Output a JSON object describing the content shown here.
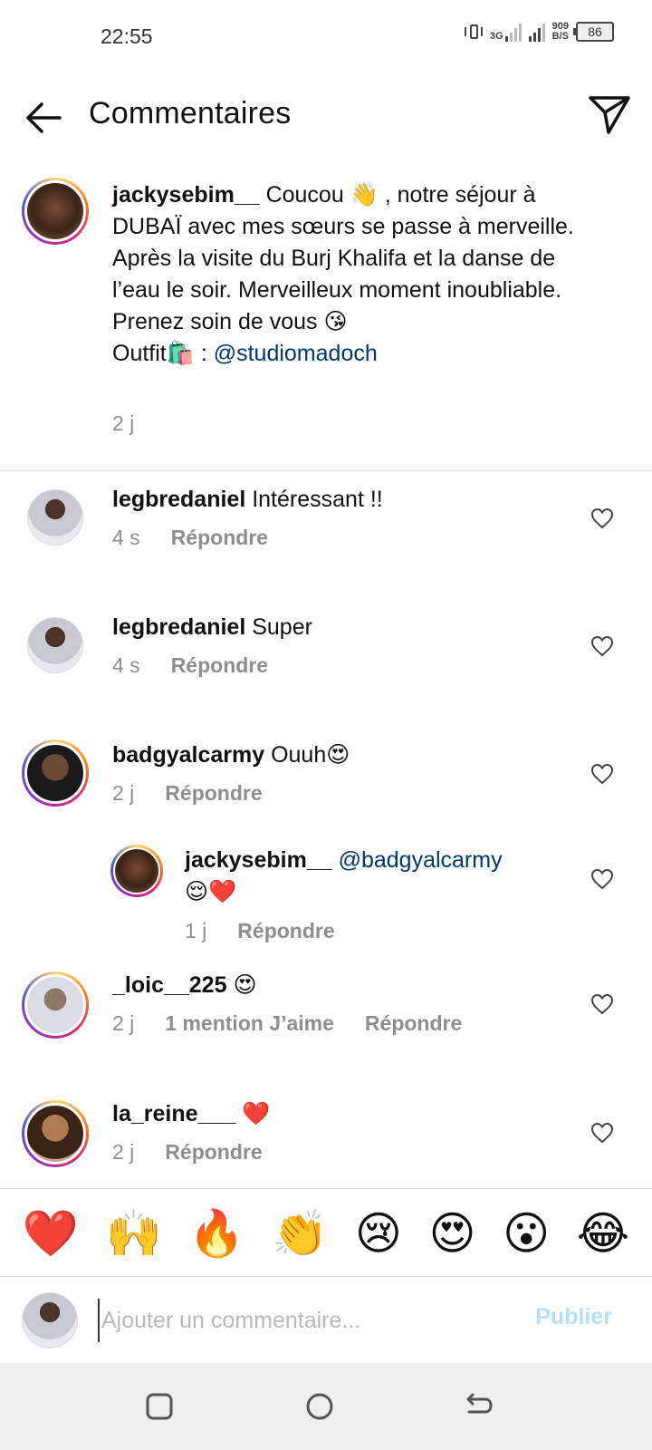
{
  "status_bar": {
    "time": "22:55",
    "network_type": "3G",
    "speed_value": "909",
    "speed_unit": "B/S",
    "battery": "86"
  },
  "header": {
    "title": "Commentaires",
    "back_icon": "arrow-left-icon",
    "send_icon": "paper-plane-icon"
  },
  "caption": {
    "username": "jackysebim__",
    "text_1": " Coucou 👋 , notre séjour à DUBAÏ avec mes sœurs se passe à merveille. Après la visite du Burj Khalifa et la danse de l’eau le soir. Merveilleux moment inoubliable. Prenez soin de vous 😘",
    "text_2": "Outfit🛍️ : ",
    "mention": "@studiomadoch",
    "time": "2 j"
  },
  "comments": [
    {
      "username": "legbredaniel",
      "text": " Intéressant !!",
      "time": "4 s",
      "reply": "Répondre"
    },
    {
      "username": "legbredaniel",
      "text": " Super",
      "time": "4 s",
      "reply": "Répondre"
    },
    {
      "username": "badgyalcarmy",
      "text": " Ouuh😍",
      "time": "2 j",
      "reply": "Répondre"
    },
    {
      "username": "jackysebim__",
      "mention": " @badgyalcarmy",
      "text": "😌❤️",
      "time": "1 j",
      "reply": "Répondre"
    },
    {
      "username": "_loic__225",
      "text": " 😍",
      "time": "2 j",
      "likes": "1 mention J’aime",
      "reply": "Répondre"
    },
    {
      "username": "la_reine___",
      "text": " ❤️",
      "time": "2 j",
      "reply": "Répondre"
    }
  ],
  "quick_emojis": [
    "❤️",
    "🙌",
    "🔥",
    "👏",
    "😢",
    "😍",
    "😮",
    "😂"
  ],
  "composer": {
    "placeholder": "Ajouter un commentaire...",
    "publish_label": "Publier"
  },
  "colors": {
    "mention": "#00376b",
    "meta_gray": "#8e8e8e",
    "publish_disabled": "#b2dffc"
  }
}
